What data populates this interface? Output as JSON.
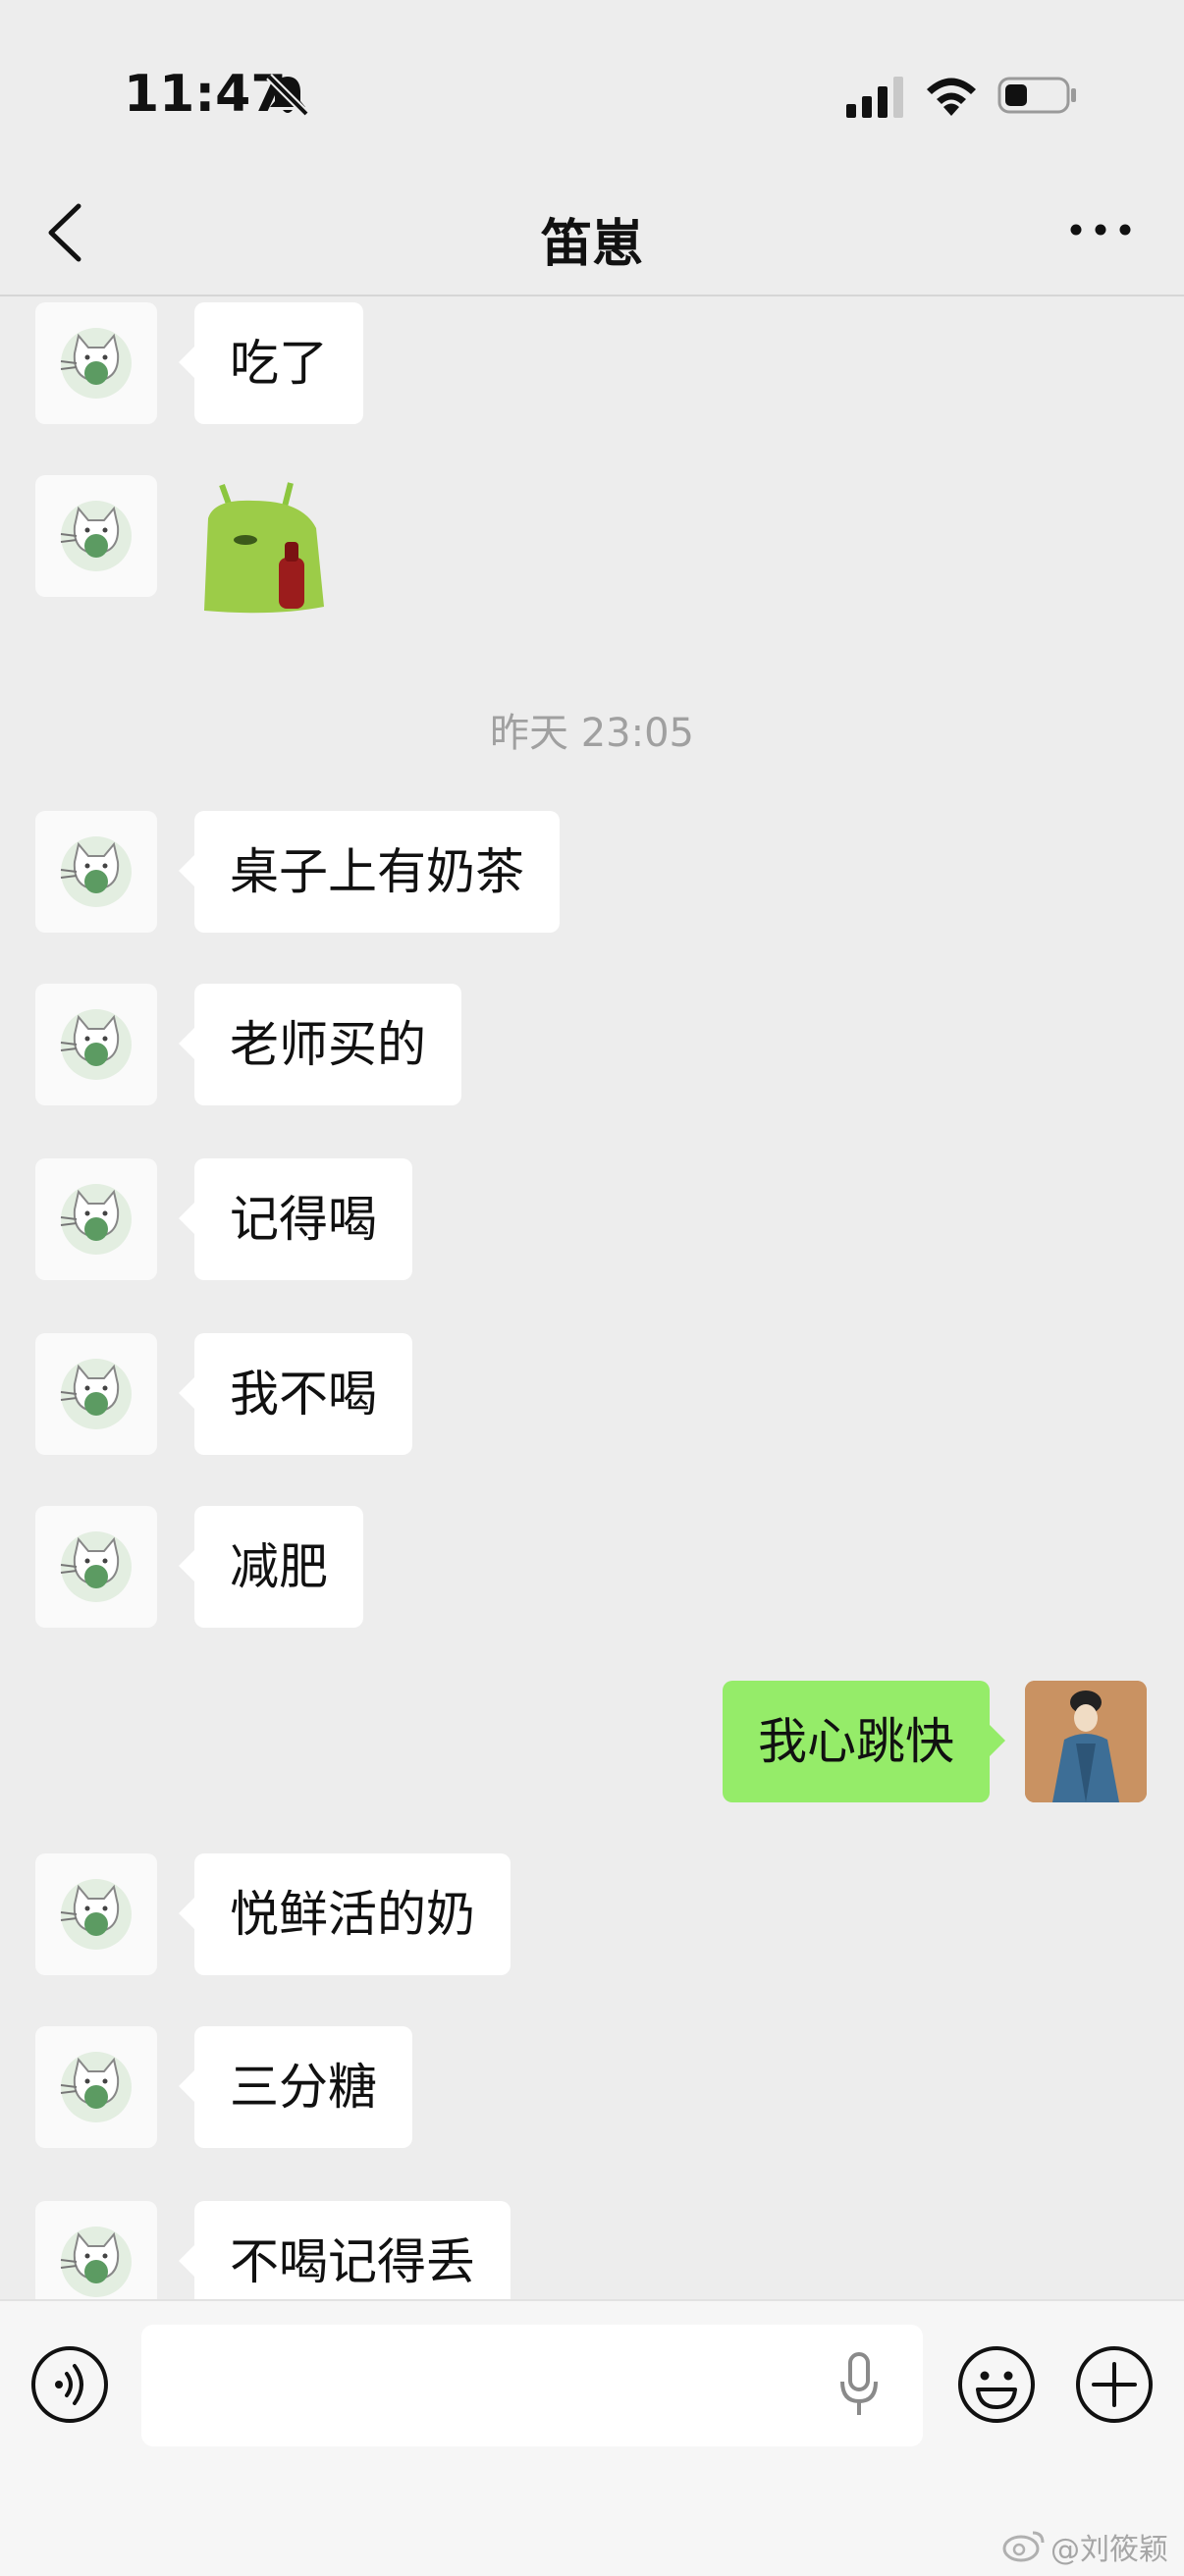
{
  "status_bar": {
    "time": "11:47",
    "icons": [
      "bell-slash-icon",
      "cellular-signal-icon",
      "wifi-icon",
      "battery-icon"
    ]
  },
  "nav": {
    "title": "笛崽",
    "back_icon": "chevron-left-icon",
    "more_icon": "more-dots-icon"
  },
  "messages": [
    {
      "side": "left",
      "text": "吃了"
    },
    {
      "side": "left",
      "sticker": "green-creature-sticker"
    },
    {
      "timestamp": "昨天 23:05"
    },
    {
      "side": "left",
      "text": "桌子上有奶茶"
    },
    {
      "side": "left",
      "text": "老师买的"
    },
    {
      "side": "left",
      "text": "记得喝"
    },
    {
      "side": "left",
      "text": "我不喝"
    },
    {
      "side": "left",
      "text": "减肥"
    },
    {
      "side": "right",
      "text": "我心跳快"
    },
    {
      "side": "left",
      "text": "悦鲜活的奶"
    },
    {
      "side": "left",
      "text": "三分糖"
    },
    {
      "side": "left",
      "text": "不喝记得丢"
    }
  ],
  "input_bar": {
    "value": "",
    "placeholder": "",
    "icons": [
      "voice-icon",
      "microphone-icon",
      "emoji-icon",
      "plus-icon"
    ]
  },
  "watermark": "@刘筱颖",
  "colors": {
    "background": "#ededed",
    "bubble_left": "#ffffff",
    "bubble_right": "#95ec69",
    "timestamp": "#a0a0a0"
  }
}
